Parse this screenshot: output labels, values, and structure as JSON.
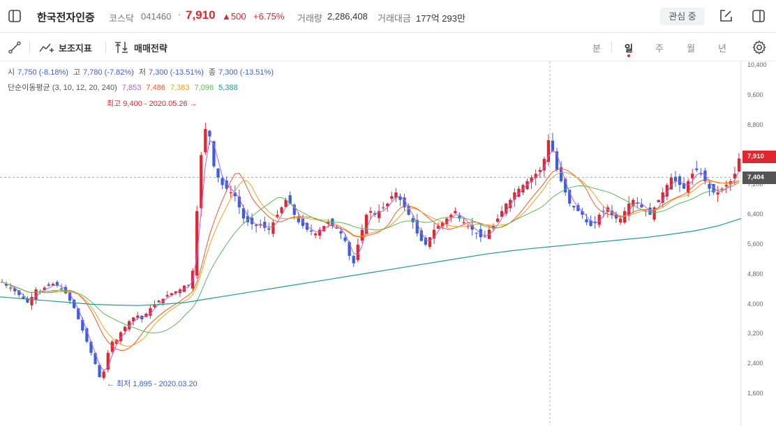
{
  "header": {
    "stock_name": "한국전자인증",
    "market": "코스닥",
    "code": "041460",
    "separator": "·",
    "price": "7,910",
    "change": "▲500",
    "change_pct": "+6.75%",
    "volume_label": "거래량",
    "volume": "2,286,408",
    "amount_label": "거래대금",
    "amount": "177억 293만",
    "watch_label": "관심 중"
  },
  "toolbar": {
    "indicators_label": "보조지표",
    "strategy_label": "매매전략",
    "periods": [
      "분",
      "일",
      "주",
      "월",
      "년"
    ],
    "active_period": "일"
  },
  "chart": {
    "ohlc": {
      "open_label": "시",
      "open": "7,750 (-8.18%)",
      "high_label": "고",
      "high": "7,780 (-7.82%)",
      "low_label": "저",
      "low": "7,300 (-13.51%)",
      "close_label": "종",
      "close": "7,300 (-13.51%)"
    },
    "ma": {
      "label": "단순이동평균 (3, 10, 12, 20, 240)",
      "values": [
        "7,853",
        "7,486",
        "7,383",
        "7,096",
        "5,388"
      ],
      "colors": [
        "#b75ee0",
        "#f05a28",
        "#f0a21f",
        "#5cb85c",
        "#1f9a95"
      ]
    },
    "high_note": "최고 9,400 - 2020.05.26 →",
    "low_note": "← 최저 1,895 - 2020.03.20",
    "current_price_tag": "7,910",
    "crosshair_tag": "7,404",
    "up_color": "#e0272f",
    "down_color": "#3b5fd9"
  },
  "chart_data": {
    "type": "candlestick",
    "title": "한국전자인증",
    "y_ticks": [
      "10,400",
      "9,600",
      "8,800",
      "8,000",
      "7,200",
      "6,400",
      "5,600",
      "4,800",
      "4,000",
      "3,200",
      "2,400",
      "1,600"
    ],
    "ylim": [
      1200,
      10600
    ],
    "y_tick_values": [
      10400,
      9600,
      8800,
      8000,
      7200,
      6400,
      5600,
      4800,
      4000,
      3200,
      2400,
      1600
    ],
    "close_series": [
      4600,
      4500,
      4450,
      4350,
      4250,
      4150,
      4050,
      4200,
      4400,
      4350,
      4450,
      4500,
      4550,
      4500,
      4400,
      4300,
      4100,
      3900,
      3600,
      3300,
      3000,
      2700,
      2400,
      2050,
      2200,
      2700,
      3000,
      3050,
      3250,
      3400,
      3550,
      3650,
      3700,
      3600,
      3750,
      3900,
      4000,
      4100,
      4150,
      4250,
      4300,
      4350,
      4400,
      4500,
      4500,
      4900,
      6500,
      8000,
      8700,
      8500,
      7700,
      7400,
      7200,
      7100,
      7000,
      6900,
      6600,
      6300,
      6200,
      6150,
      6100,
      6150,
      6050,
      6000,
      6200,
      6400,
      6600,
      6800,
      6700,
      6400,
      6200,
      6100,
      6000,
      5950,
      5900,
      6000,
      6100,
      6200,
      6100,
      6050,
      5900,
      5700,
      5300,
      5100,
      5600,
      6000,
      6400,
      6500,
      6400,
      6500,
      6600,
      6700,
      6900,
      7000,
      6800,
      6600,
      6400,
      6200,
      5900,
      5700,
      5600,
      5800,
      6000,
      6100,
      6200,
      6300,
      6400,
      6500,
      6300,
      6200,
      6100,
      6000,
      5900,
      5800,
      5800,
      6000,
      6100,
      6300,
      6500,
      6700,
      6800,
      7000,
      7100,
      7200,
      7300,
      7400,
      7500,
      7600,
      7900,
      8400,
      8100,
      7600,
      7300,
      7000,
      6700,
      6600,
      6500,
      6400,
      6200,
      6100,
      6200,
      6400,
      6500,
      6600,
      6400,
      6300,
      6300,
      6500,
      6700,
      6800,
      6700,
      6600,
      6500,
      6400,
      6600,
      6800,
      7000,
      7200,
      7400,
      7300,
      7200,
      7100,
      7300,
      7500,
      7600,
      7500,
      7300,
      7100,
      7000,
      7000,
      7100,
      7200,
      7300,
      7500,
      7910
    ],
    "ma240_series": [
      4200,
      4150,
      4100,
      4050,
      4000,
      3980,
      3970,
      4000,
      4050,
      4150,
      4250,
      4350,
      4450,
      4550,
      4650,
      4750,
      4850,
      4950,
      5050,
      5150,
      5250,
      5350,
      5430,
      5500,
      5560,
      5620,
      5680,
      5740,
      5800,
      5880,
      5970,
      6100,
      6300
    ],
    "high_point": {
      "label": "최고",
      "value": 9400,
      "date": "2020.05.26"
    },
    "low_point": {
      "label": "최저",
      "value": 1895,
      "date": "2020.03.20"
    },
    "current_price": 7910,
    "crosshair_price": 7404
  }
}
